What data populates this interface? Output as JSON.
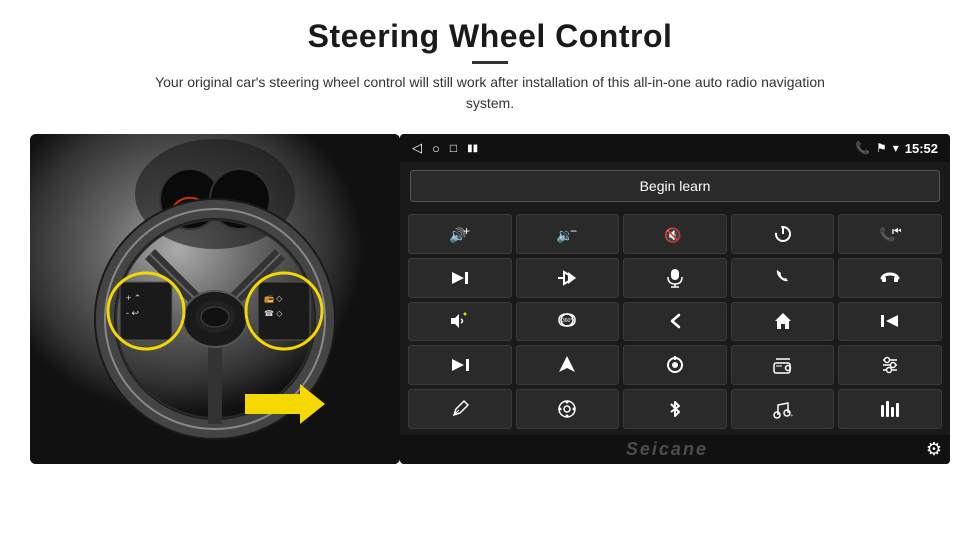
{
  "page": {
    "title": "Steering Wheel Control",
    "divider": true,
    "subtitle": "Your original car's steering wheel control will still work after installation of this all-in-one auto radio navigation system."
  },
  "status_bar": {
    "nav_back": "◁",
    "nav_circle": "○",
    "nav_square": "□",
    "signal": "▮▮",
    "phone_icon": "📞",
    "location_icon": "⚑",
    "wifi_icon": "▾",
    "time": "15:52"
  },
  "begin_learn": {
    "label": "Begin learn"
  },
  "controls": [
    {
      "icon": "🔊+",
      "name": "vol-up"
    },
    {
      "icon": "🔉−",
      "name": "vol-down"
    },
    {
      "icon": "🔇",
      "name": "mute"
    },
    {
      "icon": "⏻",
      "name": "power"
    },
    {
      "icon": "⏮",
      "name": "prev-track"
    },
    {
      "icon": "⏭",
      "name": "next"
    },
    {
      "icon": "✂⏭",
      "name": "fast-forward"
    },
    {
      "icon": "🎤",
      "name": "mic"
    },
    {
      "icon": "📞",
      "name": "call"
    },
    {
      "icon": "↩",
      "name": "hang-up"
    },
    {
      "icon": "📢",
      "name": "speaker"
    },
    {
      "icon": "360°",
      "name": "camera-360"
    },
    {
      "icon": "↩",
      "name": "back"
    },
    {
      "icon": "⌂",
      "name": "home"
    },
    {
      "icon": "⏮⏮",
      "name": "rew"
    },
    {
      "icon": "⏭⏭",
      "name": "ff"
    },
    {
      "icon": "▶",
      "name": "play"
    },
    {
      "icon": "⊜",
      "name": "source"
    },
    {
      "icon": "📻",
      "name": "radio"
    },
    {
      "icon": "⚙",
      "name": "eq"
    },
    {
      "icon": "✏",
      "name": "pen"
    },
    {
      "icon": "⊛",
      "name": "menu"
    },
    {
      "icon": "✱",
      "name": "bluetooth"
    },
    {
      "icon": "♬",
      "name": "music"
    },
    {
      "icon": "|||",
      "name": "eq2"
    }
  ],
  "bottom": {
    "brand": "Seicane",
    "gear_icon": "⚙"
  },
  "colors": {
    "screen_bg": "#1a1a1a",
    "btn_bg": "#2a2a2a",
    "btn_border": "#3a3a3a",
    "text": "#ffffff",
    "circle_highlight": "#f5d800"
  }
}
